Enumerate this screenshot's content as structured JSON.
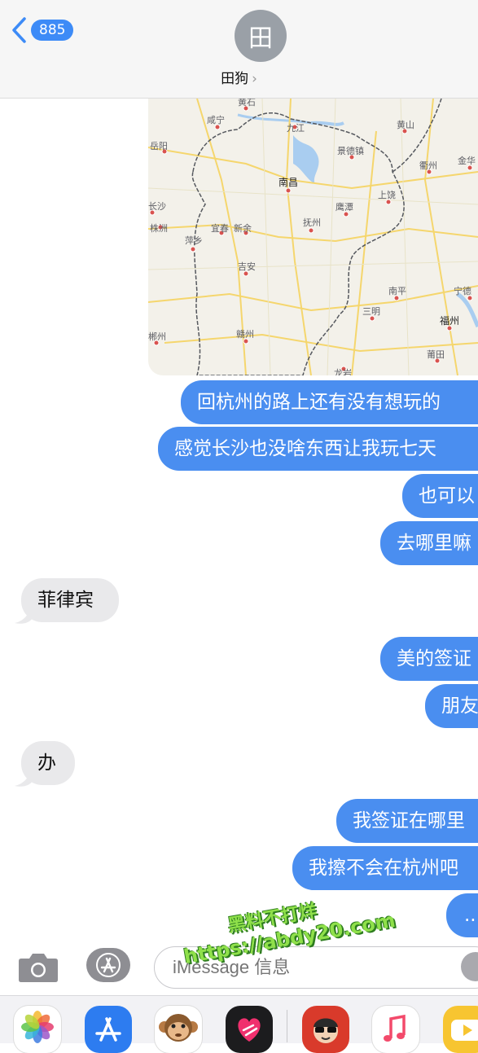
{
  "header": {
    "back_count": "885",
    "avatar_initial": "田",
    "contact_name": "田狗",
    "chevron": "›"
  },
  "map": {
    "cities": [
      "黄石",
      "咸宁",
      "九江",
      "黄山",
      "岳阳",
      "景德镇",
      "衢州",
      "金华",
      "南昌",
      "长沙",
      "鹰潭",
      "上饶",
      "株洲",
      "宜春",
      "新余",
      "抚州",
      "萍乡",
      "吉安",
      "南平",
      "宁德",
      "三明",
      "福州",
      "郴州",
      "赣州",
      "莆田",
      "龙岩"
    ]
  },
  "messages": [
    {
      "side": "sent",
      "text": "回杭州的路上还有没有想玩的"
    },
    {
      "side": "sent",
      "text": "感觉长沙也没啥东西让我玩七天"
    },
    {
      "side": "sent",
      "text": "也可以"
    },
    {
      "side": "sent",
      "text": "去哪里嘛"
    },
    {
      "side": "recv",
      "text": "菲律宾"
    },
    {
      "side": "sent",
      "text": "美的签证"
    },
    {
      "side": "sent",
      "text": "朋友"
    },
    {
      "side": "recv",
      "text": "办"
    },
    {
      "side": "sent",
      "text": "我签证在哪里"
    },
    {
      "side": "sent",
      "text": "我擦不会在杭州吧"
    },
    {
      "side": "sent",
      "text": "..."
    }
  ],
  "input": {
    "placeholder": "iMessage 信息"
  },
  "watermark": {
    "line1": "黑料不打烊",
    "line2": "https://abdy20.com"
  },
  "tray": {
    "icons": [
      "photos-icon",
      "app-store-icon",
      "animoji-monkey-icon",
      "digital-touch-icon",
      "memoji-icon",
      "music-icon",
      "youtube-icon"
    ]
  },
  "colors": {
    "sent_bubble": "#4a8ef0",
    "received_bubble": "#e9e9eb",
    "accent": "#3d8bf7"
  }
}
